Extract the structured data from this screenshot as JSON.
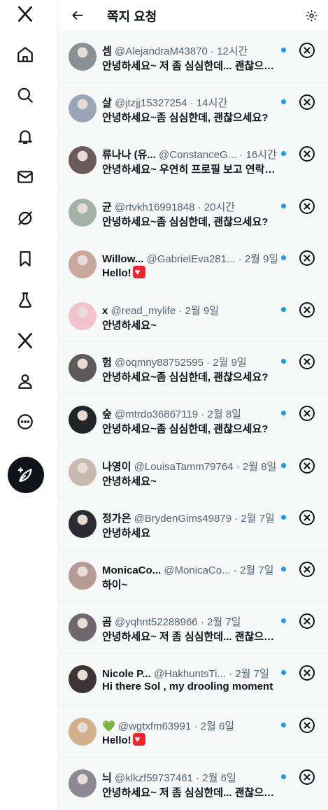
{
  "header": {
    "title": "쪽지 요청"
  },
  "sidebar": {
    "icons": [
      "x-logo-icon",
      "home-icon",
      "search-icon",
      "notifications-icon",
      "messages-icon",
      "grok-icon",
      "bookmarks-icon",
      "labs-icon",
      "premium-x-icon",
      "profile-icon",
      "more-icon"
    ],
    "compose_icon": "compose-post-icon"
  },
  "requests": [
    {
      "name": "셈",
      "handle": "@AlejandraM43870",
      "time": "12시간",
      "message": "안녕하세요~ 저 좀 심심한데... 괜찮으세요?",
      "avatar_color": "#8a8f96"
    },
    {
      "name": "살",
      "handle": "@jtzjj15327254",
      "time": "14시간",
      "message": "안녕하세요~좀 심심한데, 괜찮으세요?",
      "avatar_color": "#9aa6b8"
    },
    {
      "name": "류나나 (유...",
      "handle": "@ConstanceG...",
      "time": "16시간",
      "message": "안녕하세요~ 우연히 프로필 보고 연락드려요",
      "avatar_color": "#6b5a5c"
    },
    {
      "name": "균",
      "handle": "@rtvkh16991848",
      "time": "20시간",
      "message": "안녕하세요~좀 심심한데, 괜찮으세요?",
      "avatar_color": "#a3b1a8"
    },
    {
      "name": "Willow...",
      "handle": "@GabrielEva281...",
      "time": "2월 9일",
      "message": "Hello!",
      "heart": "red",
      "avatar_color": "#c9a79c"
    },
    {
      "name": "x",
      "handle": "@read_mylife",
      "time": "2월 9일",
      "message": "안녕하세요~",
      "avatar_color": "#f2c3cf"
    },
    {
      "name": "험",
      "handle": "@oqmny88752595",
      "time": "2월 9일",
      "message": "안녕하세요~좀 심심한데, 괜찮으세요?",
      "avatar_color": "#5d5a59"
    },
    {
      "name": "숲",
      "handle": "@mtrdo36867119",
      "time": "2월 8일",
      "message": "안녕하세요~좀 심심한데, 괜찮으세요?",
      "avatar_color": "#222426"
    },
    {
      "name": "나영이",
      "handle": "@LouisaTamm79764",
      "time": "2월 8일",
      "message": "안녕하세요~",
      "avatar_color": "#c9b8ad"
    },
    {
      "name": "정가은",
      "handle": "@BrydenGims49879",
      "time": "2월 7일",
      "message": "안녕하세요",
      "avatar_color": "#2b2b30"
    },
    {
      "name": "MonicaCo...",
      "handle": "@MonicaCo...",
      "time": "2월 7일",
      "message": "하이~",
      "avatar_color": "#b69a94"
    },
    {
      "name": "곰",
      "handle": "@yqhnt52288966",
      "time": "2월 7일",
      "message": "안녕하세요~ 저 좀 심심한데... 괜찮으세요?",
      "avatar_color": "#6f6670"
    },
    {
      "name": "Nicole P...",
      "handle": "@HakhuntsTi...",
      "time": "2월 7일",
      "message": "Hi there Sol , my drooling moment",
      "avatar_color": "#3d3535"
    },
    {
      "name": "💚",
      "handle": "@wgtxfm63991",
      "time": "2월 6일",
      "message": "Hello!",
      "heart": "red",
      "avatar_color": "#d3b08d"
    },
    {
      "name": "늬",
      "handle": "@klkzf59737461",
      "time": "2월 6일",
      "message": "안녕하세요~ 저 좀 심심한데... 괜찮으세요?",
      "avatar_color": "#8d8895"
    }
  ]
}
